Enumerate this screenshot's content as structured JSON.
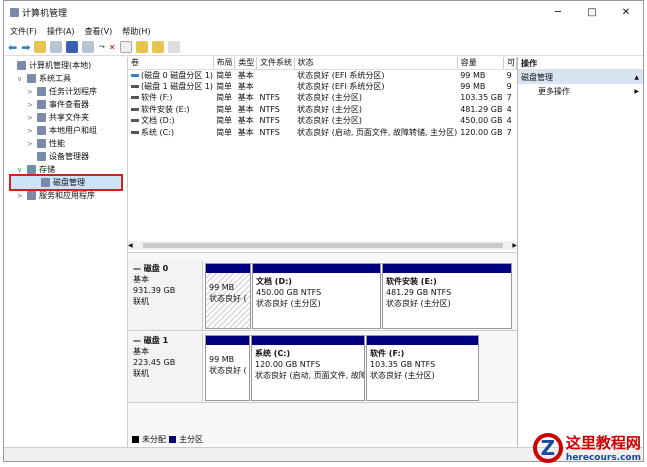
{
  "title": "计算机管理",
  "menu": [
    "文件(F)",
    "操作(A)",
    "查看(V)",
    "帮助(H)"
  ],
  "tree": [
    {
      "label": "计算机管理(本地)",
      "level": 0,
      "arrow": ""
    },
    {
      "label": "系统工具",
      "level": 1,
      "arrow": "∨"
    },
    {
      "label": "任务计划程序",
      "level": 2,
      "arrow": ">"
    },
    {
      "label": "事件查看器",
      "level": 2,
      "arrow": ">"
    },
    {
      "label": "共享文件夹",
      "level": 2,
      "arrow": ">"
    },
    {
      "label": "本地用户和组",
      "level": 2,
      "arrow": ">"
    },
    {
      "label": "性能",
      "level": 2,
      "arrow": ">"
    },
    {
      "label": "设备管理器",
      "level": 2,
      "arrow": ""
    },
    {
      "label": "存储",
      "level": 1,
      "arrow": "∨"
    },
    {
      "label": "磁盘管理",
      "level": 2,
      "arrow": ""
    },
    {
      "label": "服务和应用程序",
      "level": 1,
      "arrow": ">"
    }
  ],
  "columns": [
    "卷",
    "布局",
    "类型",
    "文件系统",
    "状态",
    "容量",
    "可"
  ],
  "volumes": [
    [
      "(磁盘 0 磁盘分区 1)",
      "简单",
      "基本",
      "",
      "状态良好 (EFI 系统分区)",
      "99 MB",
      "9"
    ],
    [
      "(磁盘 1 磁盘分区 1)",
      "简单",
      "基本",
      "",
      "状态良好 (EFI 系统分区)",
      "99 MB",
      "9"
    ],
    [
      "软件 (F:)",
      "简单",
      "基本",
      "NTFS",
      "状态良好 (主分区)",
      "103.35 GB",
      "7"
    ],
    [
      "软件安装 (E:)",
      "简单",
      "基本",
      "NTFS",
      "状态良好 (主分区)",
      "481.29 GB",
      "4"
    ],
    [
      "文档 (D:)",
      "简单",
      "基本",
      "NTFS",
      "状态良好 (主分区)",
      "450.00 GB",
      "4"
    ],
    [
      "系统 (C:)",
      "简单",
      "基本",
      "NTFS",
      "状态良好 (启动, 页面文件, 故障转储, 主分区)",
      "120.00 GB",
      "7"
    ]
  ],
  "disks": [
    {
      "name": "磁盘 0",
      "type": "基本",
      "size": "931.39 GB",
      "state": "联机",
      "parts": [
        {
          "name": "",
          "size": "99 MB",
          "status": "状态良好 (",
          "hatch": true,
          "w": 46
        },
        {
          "name": "文档 (D:)",
          "size": "450.00 GB NTFS",
          "status": "状态良好 (主分区)",
          "hatch": false,
          "w": 129
        },
        {
          "name": "软件安装 (E:)",
          "size": "481.29 GB NTFS",
          "status": "状态良好 (主分区)",
          "hatch": false,
          "w": 130
        }
      ]
    },
    {
      "name": "磁盘 1",
      "type": "基本",
      "size": "223.45 GB",
      "state": "联机",
      "parts": [
        {
          "name": "",
          "size": "99 MB",
          "status": "状态良好 (",
          "hatch": false,
          "w": 45
        },
        {
          "name": "系统 (C:)",
          "size": "120.00 GB NTFS",
          "status": "状态良好 (启动, 页面文件, 故障",
          "hatch": false,
          "w": 114
        },
        {
          "name": "软件 (F:)",
          "size": "103.35 GB NTFS",
          "status": "状态良好 (主分区)",
          "hatch": false,
          "w": 113
        }
      ]
    }
  ],
  "legend": [
    {
      "label": "未分配",
      "color": "#000000"
    },
    {
      "label": "主分区",
      "color": "#000080"
    }
  ],
  "actions": {
    "header": "操作",
    "selected": "磁盘管理",
    "more": "更多操作"
  },
  "watermark": {
    "site": "这里教程网",
    "url": "herecours.com"
  }
}
